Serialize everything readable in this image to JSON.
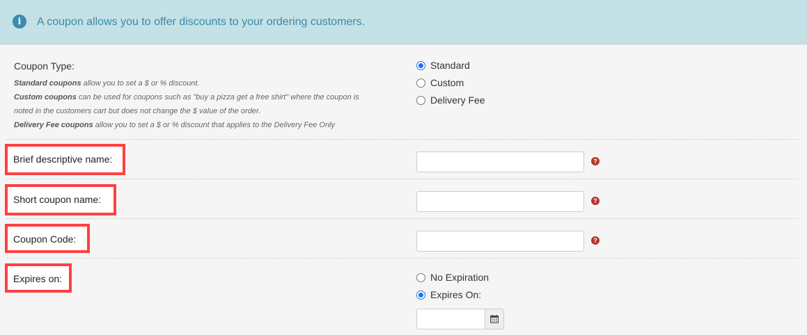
{
  "banner": {
    "icon": "info-icon",
    "message": "A coupon allows you to offer discounts to your ordering customers."
  },
  "coupon_type": {
    "label": "Coupon Type:",
    "descriptions": [
      {
        "bold": "Standard coupons",
        "text": " allow you to set a $ or % discount."
      },
      {
        "bold": "Custom coupons",
        "text": " can be used for coupons such as \"buy a pizza get a free shirt\" where the coupon is"
      },
      {
        "bold": "",
        "text": "noted in the customers cart but does not change the $ value of the order."
      },
      {
        "bold": "Delivery Fee coupons",
        "text": " allow you to set a $ or % discount that applies to the Delivery Fee Only"
      }
    ],
    "options": [
      {
        "label": "Standard",
        "checked": true
      },
      {
        "label": "Custom",
        "checked": false
      },
      {
        "label": "Delivery Fee",
        "checked": false
      }
    ]
  },
  "fields": {
    "brief_name": {
      "label": "Brief descriptive name:",
      "value": "",
      "help_icon": "question-icon"
    },
    "short_name": {
      "label": "Short coupon name:",
      "value": "",
      "help_icon": "question-icon"
    },
    "coupon_code": {
      "label": "Coupon Code:",
      "value": "",
      "help_icon": "question-icon"
    }
  },
  "expires": {
    "label": "Expires on:",
    "options": [
      {
        "label": "No Expiration",
        "checked": false
      },
      {
        "label": "Expires On:",
        "checked": true
      }
    ],
    "date_value": "",
    "calendar_icon": "calendar-icon"
  },
  "colors": {
    "banner_bg": "#c4e1e5",
    "banner_text": "#3a89ad",
    "highlight": "#ff4040",
    "radio_checked": "#1a73e8",
    "help": "#b5352f"
  },
  "help_glyph": "?",
  "info_glyph": "i"
}
